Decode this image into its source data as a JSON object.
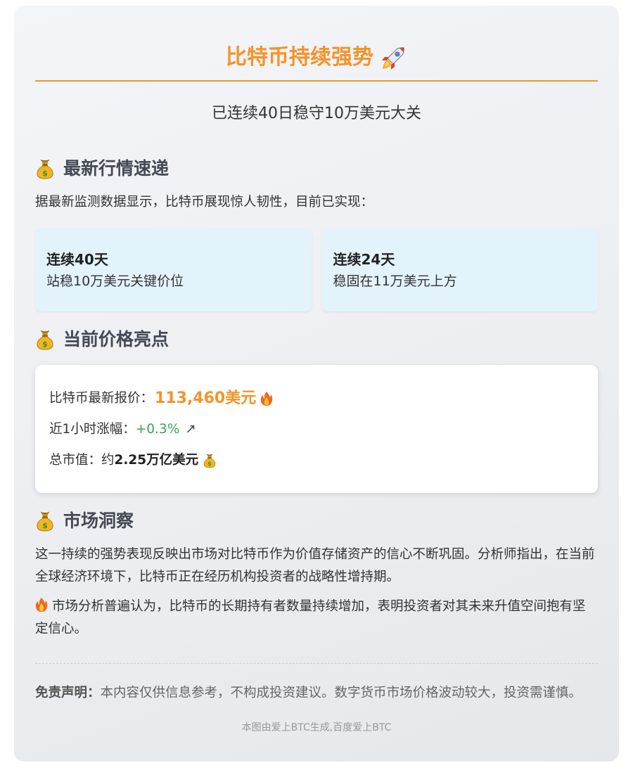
{
  "header": {
    "title": "比特币持续强势",
    "subtitle": "已连续40日稳守10万美元大关"
  },
  "market_update": {
    "heading": "最新行情速递",
    "intro": "据最新监测数据显示，比特币展现惊人韧性，目前已实现：",
    "stats": [
      {
        "title": "连续40天",
        "desc": "站稳10万美元关键价位"
      },
      {
        "title": "连续24天",
        "desc": "稳固在11万美元上方"
      }
    ]
  },
  "price_highlights": {
    "heading": "当前价格亮点",
    "latest_label": "比特币最新报价：",
    "latest_value": "113,460美元",
    "change_label": "近1小时涨幅：",
    "change_value": "+0.3%",
    "change_arrow": "↗",
    "mcap_label": "总市值：约",
    "mcap_value": "2.25万亿美元"
  },
  "insight": {
    "heading": "市场洞察",
    "paragraph1": "这一持续的强势表现反映出市场对比特币作为价值存储资产的信心不断巩固。分析师指出，在当前全球经济环境下，比特币正在经历机构投资者的战略性增持期。",
    "paragraph2": "市场分析普遍认为，比特币的长期持有者数量持续增加，表明投资者对其未来升值空间抱有坚定信心。"
  },
  "disclaimer": {
    "label": "免责声明：",
    "text": "本内容仅供信息参考，不构成投资建议。数字货币市场价格波动较大，投资需谨慎。"
  },
  "footer": {
    "text": "本图由爱上BTC生成,百度爱上BTC"
  },
  "icons": [
    "rocket-icon",
    "money-bag-icon",
    "fire-icon",
    "up-arrow-icon"
  ],
  "colors": {
    "accent": "#f3942a",
    "positive": "#3aa35a",
    "stat_bg": "#e3f3fc"
  }
}
